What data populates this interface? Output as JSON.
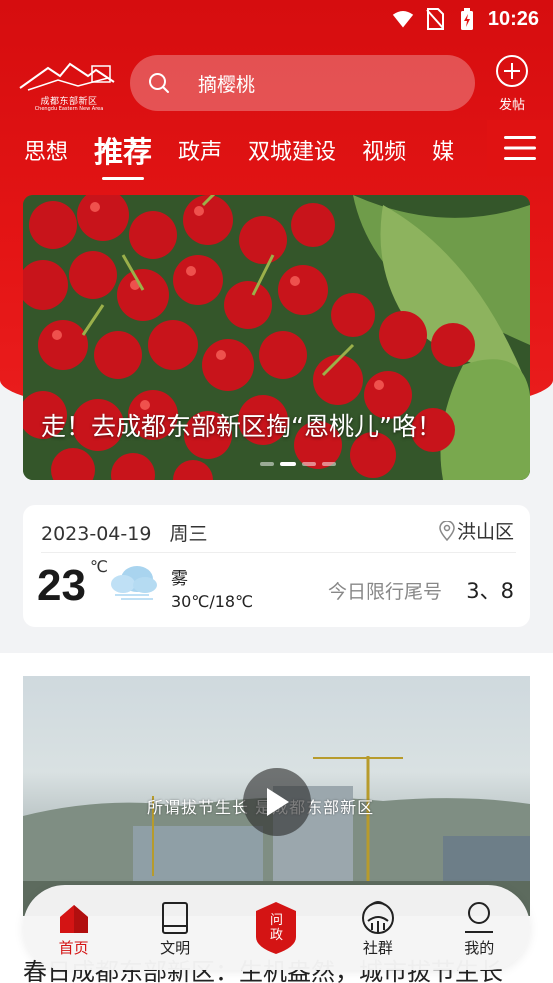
{
  "status_bar": {
    "time": "10:26"
  },
  "header": {
    "logo_text": "成都东部新区",
    "logo_subtext": "Chengdu Eastern New Area",
    "search_placeholder": "摘樱桃",
    "post_label": "发帖"
  },
  "tabs": [
    {
      "label": "思想",
      "active": false
    },
    {
      "label": "推荐",
      "active": true
    },
    {
      "label": "政声",
      "active": false
    },
    {
      "label": "双城建设",
      "active": false
    },
    {
      "label": "视频",
      "active": false
    },
    {
      "label": "媒",
      "active": false
    }
  ],
  "banner": {
    "caption": "走！去成都东部新区掏“恩桃儿”咯！",
    "slide_count": 4,
    "active_slide": 1
  },
  "weather": {
    "date": "2023-04-19",
    "weekday": "周三",
    "location": "洪山区",
    "temperature": "23",
    "unit": "℃",
    "condition": "雾",
    "range": "30℃/18℃",
    "limit_label": "今日限行尾号",
    "limit_value": "3、8"
  },
  "video": {
    "caption": "所谓拔节生长  是成都东部新区"
  },
  "article": {
    "title": "春日成都东部新区：生机盎然，城市拔节生长"
  },
  "bottom_nav": [
    {
      "label": "首页",
      "icon": "home-icon",
      "active": true
    },
    {
      "label": "文明",
      "icon": "book-icon",
      "active": false
    },
    {
      "label": "问政",
      "icon": "ask-icon",
      "active": false
    },
    {
      "label": "社群",
      "icon": "community-icon",
      "active": false
    },
    {
      "label": "我的",
      "icon": "profile-icon",
      "active": false
    }
  ],
  "colors": {
    "brand_red": "#e41515",
    "active_red": "#d41414"
  }
}
